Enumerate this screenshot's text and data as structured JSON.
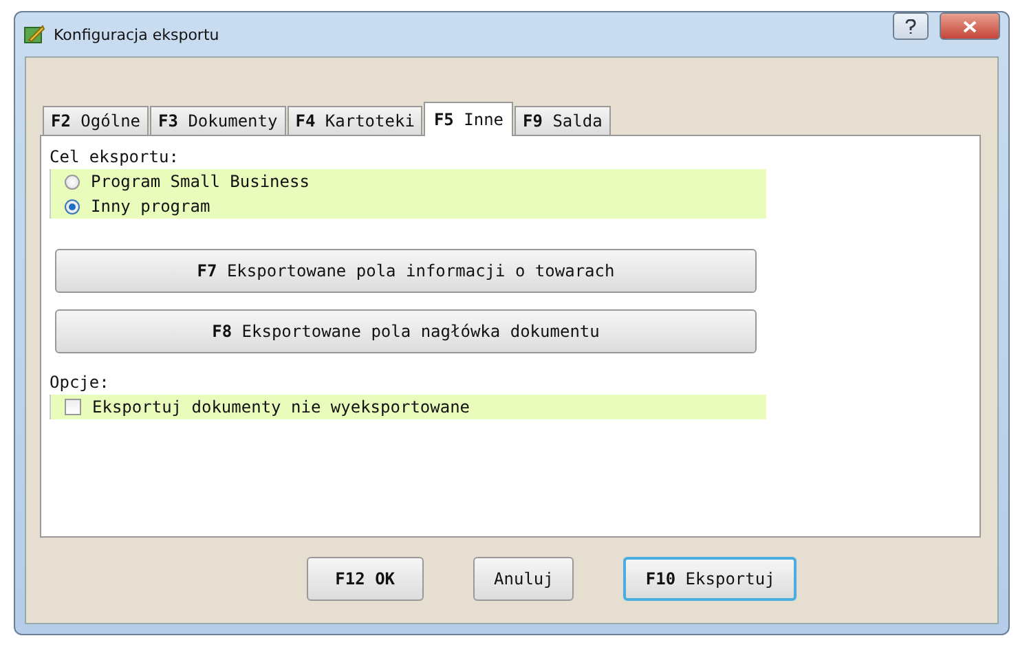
{
  "window": {
    "title": "Konfiguracja eksportu"
  },
  "tabs": [
    {
      "label": "**F2** Ogólne",
      "selected": false
    },
    {
      "label": "**F3** Dokumenty",
      "selected": false
    },
    {
      "label": "**F4** Kartoteki",
      "selected": false
    },
    {
      "label": "**F5** Inne",
      "selected": true
    },
    {
      "label": "**F9** Salda",
      "selected": false
    }
  ],
  "target": {
    "label": "Cel eksportu:",
    "options": [
      {
        "label": "Program Small Business",
        "selected": false
      },
      {
        "label": "Inny program",
        "selected": true
      }
    ]
  },
  "field_buttons": [
    "**F7** Eksportowane pola informacji o towarach",
    "**F8** Eksportowane pola nagłówka dokumentu"
  ],
  "options": {
    "label": "Opcje:",
    "items": [
      {
        "label": "Eksportuj dokumenty nie wyeksportowane",
        "checked": false
      }
    ]
  },
  "buttons": [
    {
      "label": "F12 OK",
      "bold": true,
      "focused": false
    },
    {
      "label": "Anuluj",
      "bold": false,
      "focused": false
    },
    {
      "label": "**F10** Eksportuj",
      "bold": false,
      "focused": true
    }
  ]
}
